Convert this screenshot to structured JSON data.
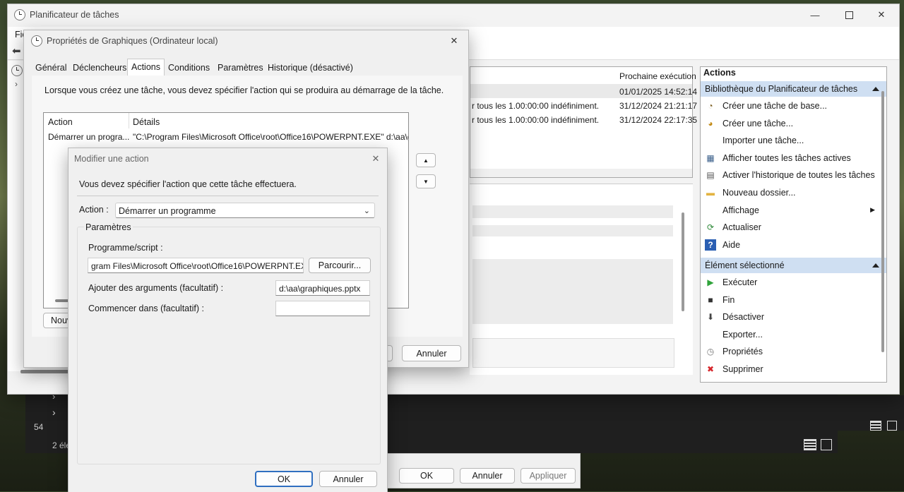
{
  "main_window": {
    "title": "Planificateur de tâches",
    "menu_partial": "Fic",
    "columns": {
      "next_run": "Prochaine exécution"
    },
    "rows": [
      {
        "trigger": "",
        "next_run": "01/01/2025 14:52:14"
      },
      {
        "trigger": "r tous les 1.00:00:00 indéfiniment.",
        "next_run": "31/12/2024 21:21:17"
      },
      {
        "trigger": "r tous les 1.00:00:00 indéfiniment.",
        "next_run": "31/12/2024 22:17:35"
      }
    ]
  },
  "actions_pane": {
    "title": "Actions",
    "library_header": "Bibliothèque du Planificateur de tâches",
    "library_items": [
      {
        "label": "Créer une tâche de base...",
        "icon": "create-basic-task-icon"
      },
      {
        "label": "Créer une tâche...",
        "icon": "create-task-icon"
      },
      {
        "label": "Importer une tâche...",
        "icon": ""
      },
      {
        "label": "Afficher toutes les tâches actives",
        "icon": "running-tasks-icon"
      },
      {
        "label": "Activer l'historique de toutes les tâches",
        "icon": "history-icon"
      },
      {
        "label": "Nouveau dossier...",
        "icon": "folder-icon"
      },
      {
        "label": "Affichage",
        "icon": "",
        "submenu": true
      },
      {
        "label": "Actualiser",
        "icon": "refresh-icon"
      },
      {
        "label": "Aide",
        "icon": "help-icon"
      }
    ],
    "selected_header": "Élément sélectionné",
    "selected_items": [
      {
        "label": "Exécuter",
        "icon": "run-icon"
      },
      {
        "label": "Fin",
        "icon": "stop-icon"
      },
      {
        "label": "Désactiver",
        "icon": "disable-icon"
      },
      {
        "label": "Exporter...",
        "icon": ""
      },
      {
        "label": "Propriétés",
        "icon": "properties-icon"
      },
      {
        "label": "Supprimer",
        "icon": "delete-icon"
      }
    ]
  },
  "properties_dialog": {
    "title": "Propriétés de Graphiques (Ordinateur local)",
    "tabs": [
      "Général",
      "Déclencheurs",
      "Actions",
      "Conditions",
      "Paramètres",
      "Historique (désactivé)"
    ],
    "active_tab": "Actions",
    "intro": "Lorsque vous créez une tâche, vous devez spécifier l'action qui se produira au démarrage de la tâche.",
    "table": {
      "headers": [
        "Action",
        "Détails"
      ],
      "rows": [
        [
          "Démarrer un progra...",
          "\"C:\\Program Files\\Microsoft Office\\root\\Office16\\POWERPNT.EXE\" d:\\aa\\grap"
        ]
      ]
    },
    "new_button_partial": "Nouv",
    "cancel": "Annuler"
  },
  "bottom_buttons": {
    "ok": "OK",
    "cancel": "Annuler",
    "apply": "Appliquer"
  },
  "background_window": {
    "count_partial": "54",
    "items_partial": "2 élé"
  },
  "edit_action_dialog": {
    "title": "Modifier une action",
    "instruction": "Vous devez spécifier l'action que cette tâche effectuera.",
    "action_label": "Action :",
    "action_value": "Démarrer un programme",
    "group_label": "Paramètres",
    "program_label": "Programme/script :",
    "program_value": "gram Files\\Microsoft Office\\root\\Office16\\POWERPNT.EXE\"",
    "browse": "Parcourir...",
    "args_label": "Ajouter des arguments (facultatif) :",
    "args_value": "d:\\aa\\graphiques.pptx",
    "start_in_label": "Commencer dans (facultatif) :",
    "start_in_value": "",
    "ok": "OK",
    "cancel": "Annuler"
  }
}
